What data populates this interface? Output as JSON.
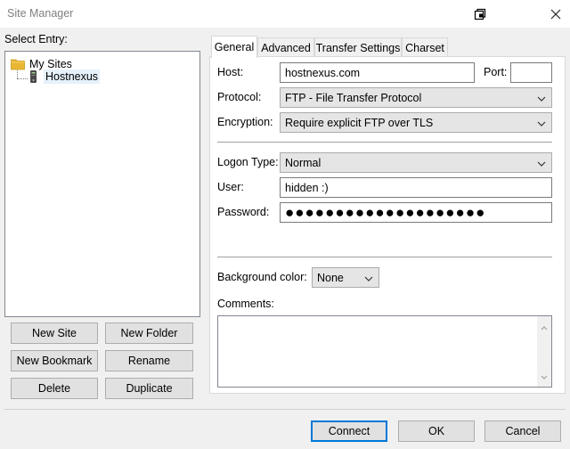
{
  "window": {
    "title": "Site Manager",
    "icons": [
      "restore-icon",
      "close-icon"
    ]
  },
  "left": {
    "select_entry_label": "Select Entry:",
    "tree": {
      "folder": "My Sites",
      "site": "Hostnexus"
    },
    "buttons": {
      "new_site": "New Site",
      "new_folder": "New Folder",
      "new_bookmark": "New Bookmark",
      "rename": "Rename",
      "delete": "Delete",
      "duplicate": "Duplicate"
    }
  },
  "tabs": [
    "General",
    "Advanced",
    "Transfer Settings",
    "Charset"
  ],
  "general": {
    "host_label": "Host:",
    "host_value": "hostnexus.com",
    "port_label": "Port:",
    "port_value": "",
    "protocol_label": "Protocol:",
    "protocol_value": "FTP - File Transfer Protocol",
    "encryption_label": "Encryption:",
    "encryption_value": "Require explicit FTP over TLS",
    "logon_type_label": "Logon Type:",
    "logon_type_value": "Normal",
    "user_label": "User:",
    "user_value": "hidden :)",
    "password_label": "Password:",
    "password_value": "●●●●●●●●●●●●●●●●●●●●",
    "bg_color_label": "Background color:",
    "bg_color_value": "None",
    "comments_label": "Comments:",
    "comments_value": ""
  },
  "footer": {
    "connect": "Connect",
    "ok": "OK",
    "cancel": "Cancel"
  },
  "colors": {
    "focus_border": "#0078d7",
    "folder": "#e8b632"
  }
}
